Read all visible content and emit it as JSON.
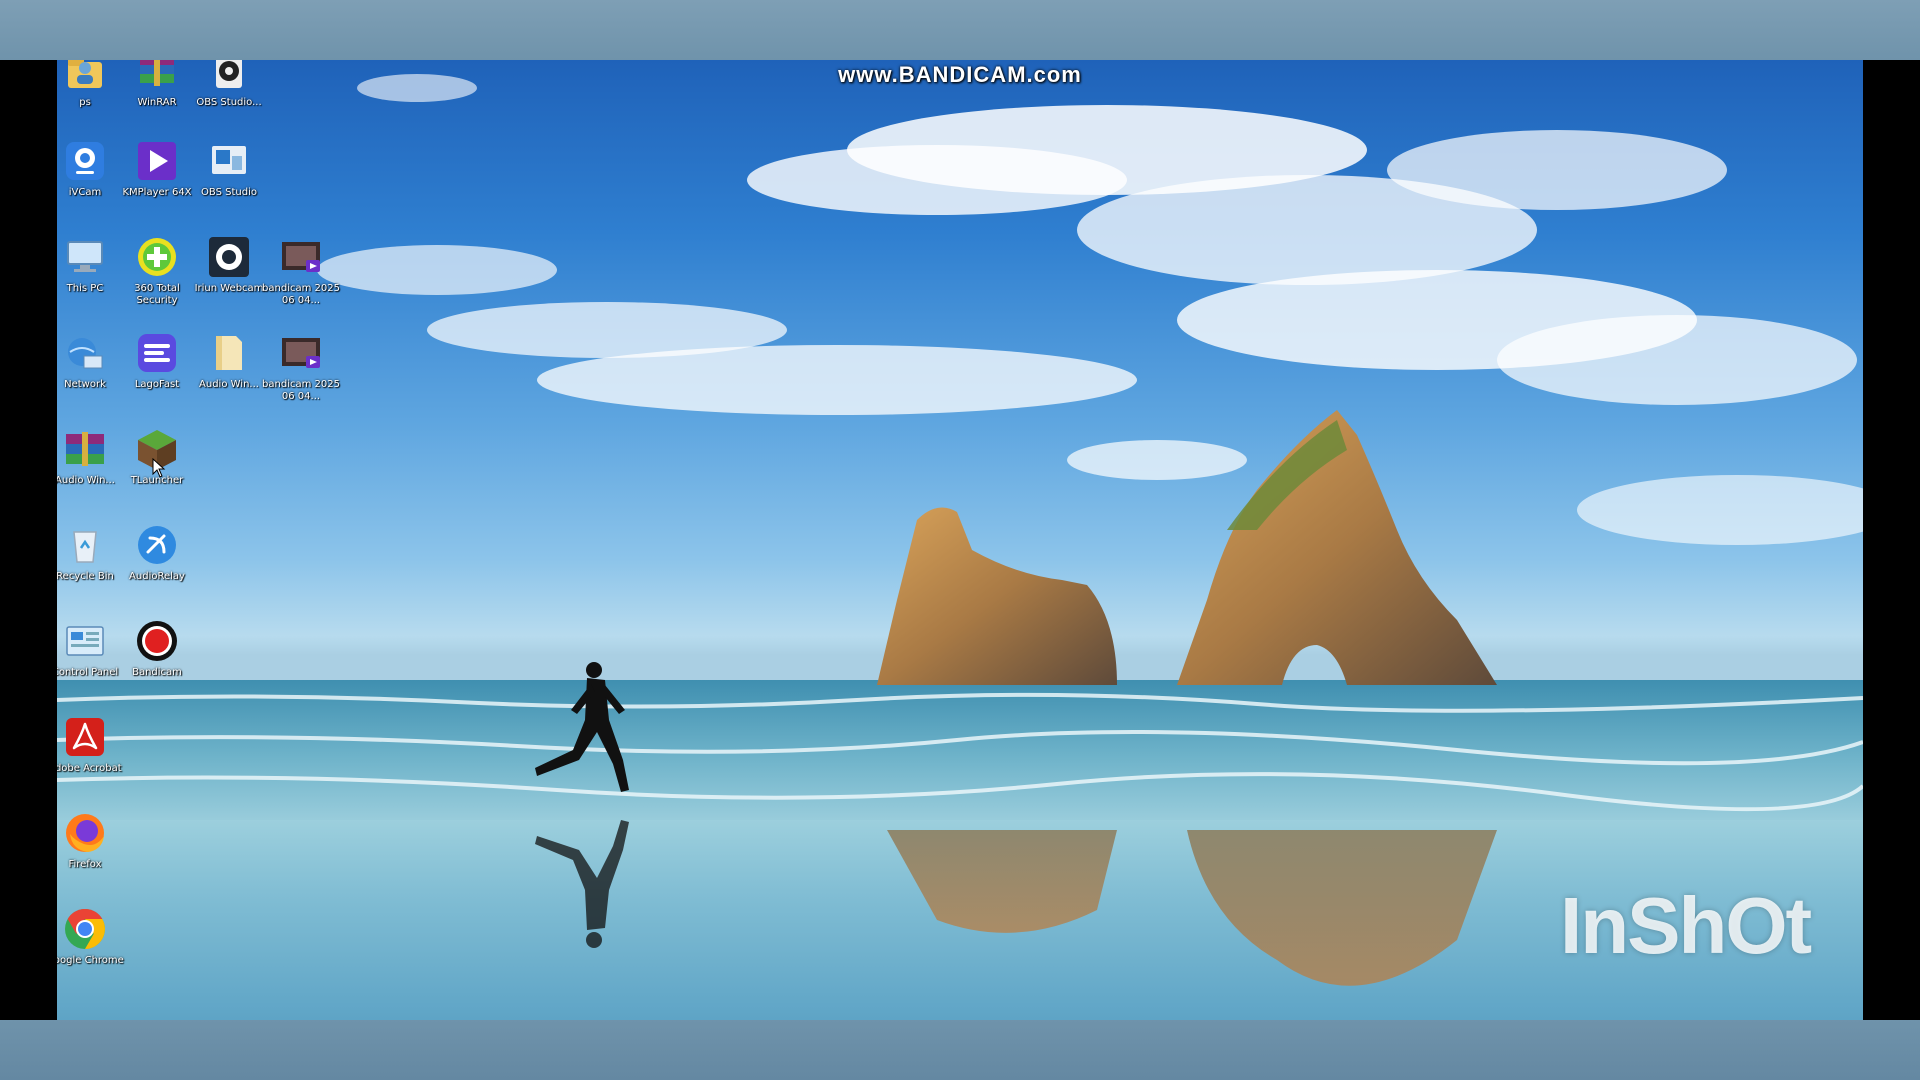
{
  "overlays": {
    "recorder_watermark": "www.BANDICAM.com",
    "editor_watermark": "InShOt"
  },
  "desktop": {
    "icons": [
      {
        "label": "ps",
        "icon": "user-folder-icon"
      },
      {
        "label": "WinRAR",
        "icon": "winrar-icon"
      },
      {
        "label": "OBS Studio...",
        "icon": "obs-studio-folder-icon"
      },
      {
        "label": "iVCam",
        "icon": "ivcam-icon"
      },
      {
        "label": "KMPlayer 64X",
        "icon": "kmplayer-icon"
      },
      {
        "label": "OBS Studio",
        "icon": "obs-studio-icon"
      },
      {
        "label": "This PC",
        "icon": "this-pc-icon"
      },
      {
        "label": "360 Total Security",
        "icon": "total-security-icon"
      },
      {
        "label": "Iriun Webcam",
        "icon": "iriun-webcam-icon"
      },
      {
        "label": "bandicam 2025 06 04...",
        "icon": "video-file-icon"
      },
      {
        "label": "Network",
        "icon": "network-icon"
      },
      {
        "label": "LagoFast",
        "icon": "lagofast-icon"
      },
      {
        "label": "Audio Win...",
        "icon": "folder-icon"
      },
      {
        "label": "bandicam 2025 06 04...",
        "icon": "video-file-icon"
      },
      {
        "label": "Audio Win...",
        "icon": "winrar-archive-icon"
      },
      {
        "label": "TLauncher",
        "icon": "tlauncher-icon"
      },
      {
        "label": "Recycle Bin",
        "icon": "recycle-bin-icon"
      },
      {
        "label": "AudioRelay",
        "icon": "audiorelay-icon"
      },
      {
        "label": "Control Panel",
        "icon": "control-panel-icon"
      },
      {
        "label": "Bandicam",
        "icon": "bandicam-icon"
      },
      {
        "label": "Adobe Acrobat",
        "icon": "adobe-acrobat-icon"
      },
      {
        "label": "Firefox",
        "icon": "firefox-icon"
      },
      {
        "label": "Google Chrome",
        "icon": "google-chrome-icon"
      }
    ]
  },
  "colors": {
    "bandicam_red": "#e02020",
    "kmplayer_purple": "#6b2fc9",
    "chrome_green": "#34a853",
    "chrome_red": "#ea4335",
    "chrome_yellow": "#fbbc05",
    "chrome_blue": "#4285f4"
  }
}
